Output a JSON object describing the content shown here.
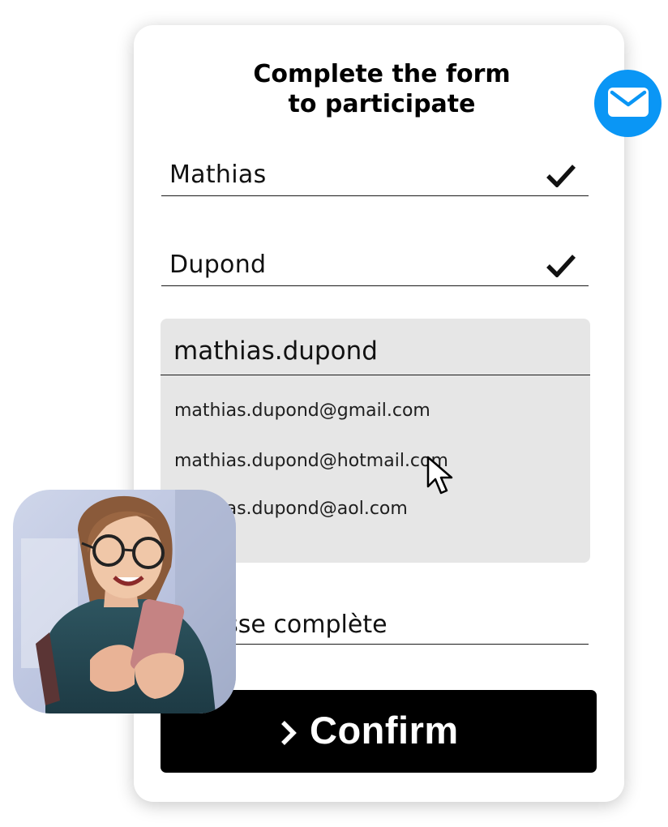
{
  "form": {
    "title_line1": "Complete the form",
    "title_line2": "to participate",
    "first_name": "Mathias",
    "last_name": "Dupond",
    "email_input": "mathias.dupond",
    "suggestions": [
      "mathias.dupond@gmail.com",
      "mathias.dupond@hotmail.com",
      "mathias.dupond@aol.com"
    ],
    "address": "Adresse complète",
    "confirm_label": "Confirm"
  },
  "icons": {
    "check": "check-icon",
    "mail": "mail-icon",
    "cursor": "cursor-icon",
    "chevron": "chevron-right-icon"
  },
  "colors": {
    "accent": "#0a96f5",
    "button": "#000000",
    "dropdown_bg": "#e6e6e6"
  }
}
